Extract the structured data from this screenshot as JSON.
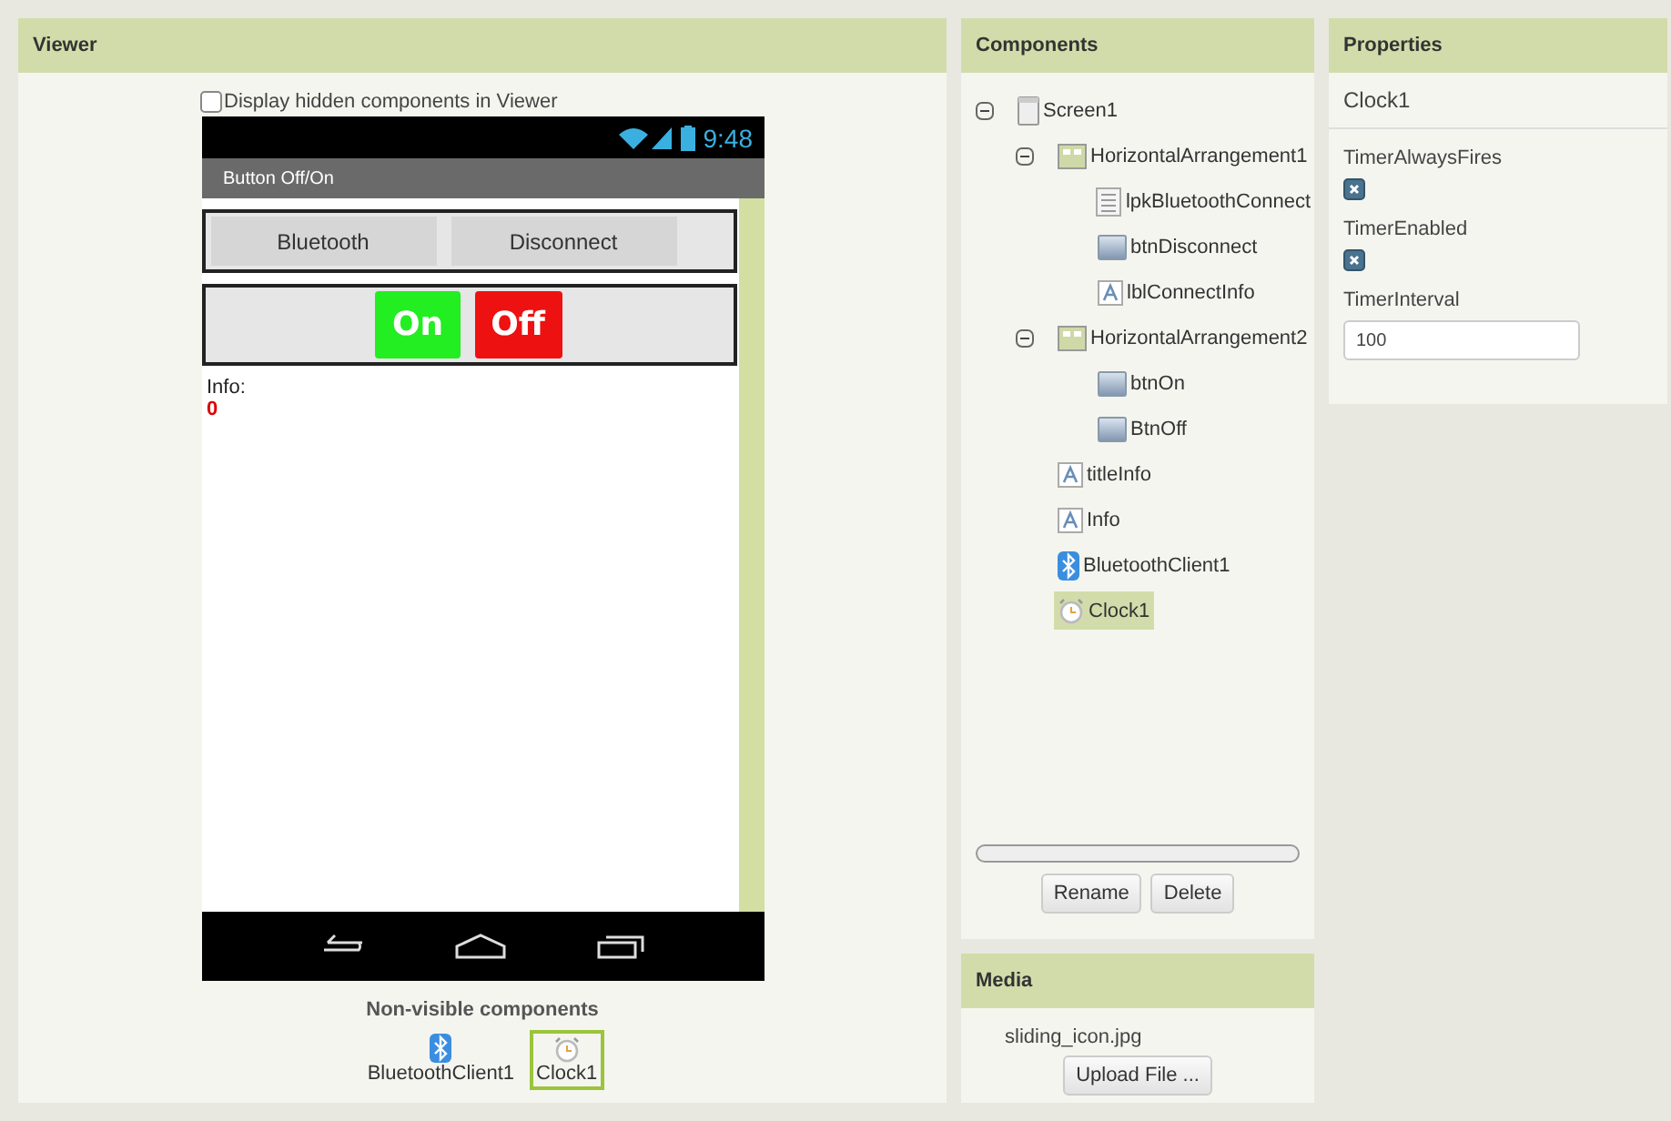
{
  "viewer": {
    "title": "Viewer",
    "hidden_toggle": {
      "label": "Display hidden components in Viewer",
      "checked": false
    },
    "phone": {
      "time": "9:48",
      "app_title": "Button Off/On",
      "arrangements": [
        {
          "buttons": [
            {
              "label": "Bluetooth",
              "kind": "plain"
            },
            {
              "label": "Disconnect",
              "kind": "plain"
            }
          ]
        },
        {
          "buttons": [
            {
              "label": "On",
              "kind": "colored",
              "color": "#22ee22"
            },
            {
              "label": "Off",
              "kind": "colored",
              "color": "#ee1111"
            }
          ]
        }
      ],
      "info_title": "Info:",
      "info_value": "0"
    },
    "nonvisible": {
      "title": "Non-visible components",
      "items": [
        {
          "label": "BluetoothClient1",
          "kind": "bluetooth",
          "selected": false
        },
        {
          "label": "Clock1",
          "kind": "clock",
          "selected": true
        }
      ]
    }
  },
  "components": {
    "title": "Components",
    "tree": [
      {
        "label": "Screen1",
        "kind": "screen",
        "expanded": true,
        "selected": false,
        "children": [
          {
            "label": "HorizontalArrangement1",
            "kind": "arrangement",
            "expanded": true,
            "selected": false,
            "children": [
              {
                "label": "lpkBluetoothConnect",
                "kind": "listpicker",
                "selected": false
              },
              {
                "label": "btnDisconnect",
                "kind": "button",
                "selected": false
              },
              {
                "label": "lblConnectInfo",
                "kind": "label",
                "selected": false
              }
            ]
          },
          {
            "label": "HorizontalArrangement2",
            "kind": "arrangement",
            "expanded": true,
            "selected": false,
            "children": [
              {
                "label": "btnOn",
                "kind": "button",
                "selected": false
              },
              {
                "label": "BtnOff",
                "kind": "button",
                "selected": false
              }
            ]
          },
          {
            "label": "titleInfo",
            "kind": "label",
            "selected": false
          },
          {
            "label": "Info",
            "kind": "label",
            "selected": false
          },
          {
            "label": "BluetoothClient1",
            "kind": "bluetooth",
            "selected": false
          },
          {
            "label": "Clock1",
            "kind": "clock",
            "selected": true
          }
        ]
      }
    ],
    "buttons": [
      "Rename",
      "Delete"
    ]
  },
  "media": {
    "title": "Media",
    "files": [
      "sliding_icon.jpg"
    ],
    "upload_button": "Upload File ..."
  },
  "properties": {
    "title": "Properties",
    "component": "Clock1",
    "items": [
      {
        "label": "TimerAlwaysFires",
        "kind": "checkbox",
        "checked": true
      },
      {
        "label": "TimerEnabled",
        "kind": "checkbox",
        "checked": true
      },
      {
        "label": "TimerInterval",
        "kind": "text",
        "value": "100"
      }
    ]
  }
}
